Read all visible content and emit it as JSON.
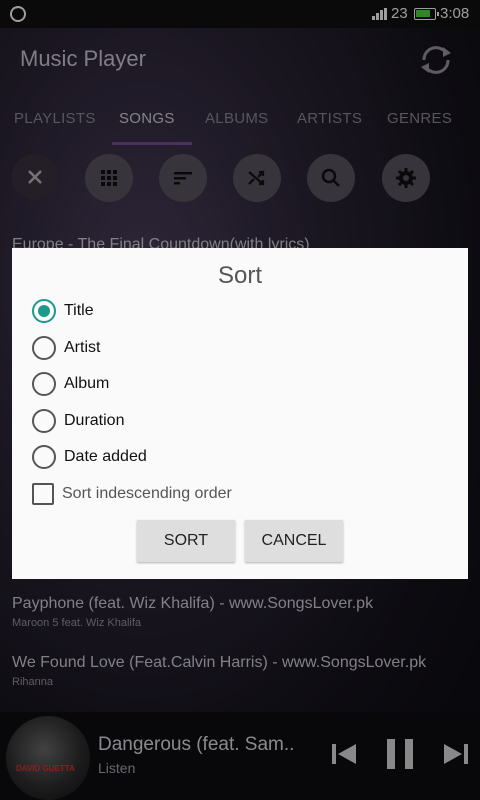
{
  "status_bar": {
    "network": "23",
    "time": "3:08"
  },
  "app": {
    "title": "Music Player"
  },
  "tabs": [
    {
      "label": "PLAYLISTS"
    },
    {
      "label": "SONGS"
    },
    {
      "label": "ALBUMS"
    },
    {
      "label": "ARTISTS"
    },
    {
      "label": "GENRES"
    }
  ],
  "toolbar_icons": [
    "close-icon",
    "grid-icon",
    "sort-icon",
    "shuffle-icon",
    "search-icon",
    "settings-icon"
  ],
  "songs": [
    {
      "title": "Europe - The Final Countdown(with lyrics)",
      "artist": ""
    },
    {
      "title": "Payphone (feat. Wiz Khalifa) - www.SongsLover.pk",
      "artist": "Maroon 5 feat. Wiz Khalifa"
    },
    {
      "title": "We Found Love (Feat.Calvin Harris) - www.SongsLover.pk",
      "artist": "Rihanna"
    }
  ],
  "now_playing": {
    "title": "Dangerous (feat. Sam..",
    "subtitle": "Listen",
    "album_art_text": "DAVID GUETTA"
  },
  "dialog": {
    "title": "Sort",
    "options": [
      {
        "label": "Title",
        "checked": true
      },
      {
        "label": "Artist",
        "checked": false
      },
      {
        "label": "Album",
        "checked": false
      },
      {
        "label": "Duration",
        "checked": false
      },
      {
        "label": "Date added",
        "checked": false
      }
    ],
    "checkbox_label": "Sort indescending order",
    "checkbox_checked": false,
    "sort_button": "SORT",
    "cancel_button": "CANCEL"
  },
  "colors": {
    "accent": "#1a9a8a",
    "tab_indicator": "#7a4fa0"
  }
}
